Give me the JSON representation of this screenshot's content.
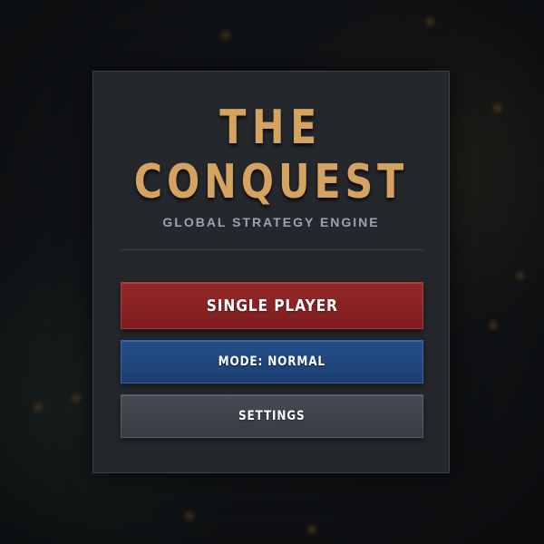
{
  "title": {
    "line1": "THE",
    "line2": "CONQUEST"
  },
  "subtitle": "GLOBAL STRATEGY ENGINE",
  "menu": {
    "single_player": "SINGLE PLAYER",
    "mode": "MODE: NORMAL",
    "settings": "SETTINGS"
  },
  "colors": {
    "title_gold": "#d4a35f",
    "subtitle_gray": "#98a3b3",
    "panel_bg": "#24272c",
    "single_player_red": "#8a2324",
    "mode_blue": "#214780",
    "settings_gray": "#40434a"
  }
}
